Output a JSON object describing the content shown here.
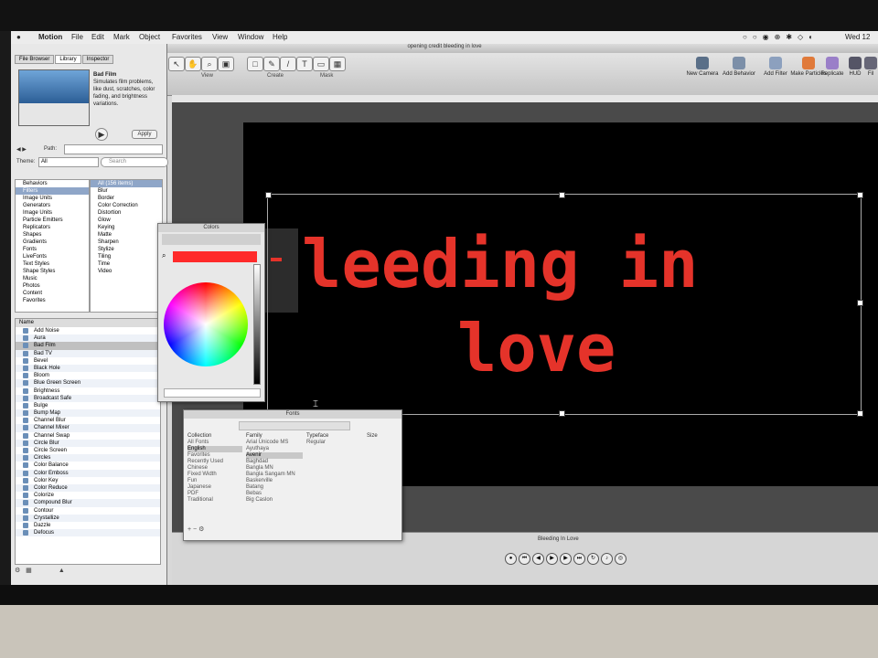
{
  "menubar": {
    "app": "Motion",
    "items": [
      "File",
      "Edit",
      "Mark",
      "Object",
      "Favorites",
      "View",
      "Window",
      "Help"
    ],
    "clock": "Wed 12"
  },
  "window": {
    "title": "opening credit bleeding in love"
  },
  "toolbar": {
    "view_label": "View",
    "create_label": "Create",
    "mask_label": "Mask",
    "right_buttons": [
      "New Camera",
      "Add Behavior",
      "Add Filter",
      "Make Particles",
      "Replicate",
      "HUD",
      "Fil"
    ]
  },
  "library": {
    "tabs": [
      "File Browser",
      "Library",
      "Inspector"
    ],
    "selected_item": "Bad Film",
    "description": "Simulates film problems, like dust, scratches, color fading, and brightness variations.",
    "apply_label": "Apply",
    "path_label": "Path:",
    "theme_label": "Theme:",
    "theme_value": "All",
    "search_placeholder": "Search",
    "categories": [
      "Behaviors",
      "Filters",
      "Image Units",
      "Generators",
      "Image Units",
      "Particle Emitters",
      "Replicators",
      "Shapes",
      "Gradients",
      "Fonts",
      "LiveFonts",
      "Text Styles",
      "Shape Styles",
      "Music",
      "Photos",
      "Content",
      "Favorites"
    ],
    "subcategories": [
      "All (156 items)",
      "Blur",
      "Border",
      "Color Correction",
      "Distortion",
      "Glow",
      "Keying",
      "Matte",
      "Sharpen",
      "Stylize",
      "Tiling",
      "Time",
      "Video"
    ],
    "list_header": "Name",
    "filters": [
      "Add Noise",
      "Aura",
      "Bad Film",
      "Bad TV",
      "Bevel",
      "Black Hole",
      "Bloom",
      "Blue Green Screen",
      "Brightness",
      "Broadcast Safe",
      "Bulge",
      "Bump Map",
      "Channel Blur",
      "Channel Mixer",
      "Channel Swap",
      "Circle Blur",
      "Circle Screen",
      "Circles",
      "Color Balance",
      "Color Emboss",
      "Color Key",
      "Color Reduce",
      "Colorize",
      "Compound Blur",
      "Contour",
      "Crystallize",
      "Dazzle",
      "Defocus"
    ]
  },
  "canvas": {
    "line1": "leeding in",
    "line2": "love",
    "text_color": "#e5332a"
  },
  "colors_panel": {
    "title": "Colors",
    "swatch_color": "#ff2a2a"
  },
  "fonts_panel": {
    "title": "Fonts",
    "collection_header": "Collection",
    "family_header": "Family",
    "typeface_header": "Typeface",
    "size_header": "Size",
    "collections": [
      "All Fonts",
      "English",
      "Favorites",
      "Recently Used",
      "Chinese",
      "Fixed Width",
      "Fun",
      "Japanese",
      "PDF",
      "Traditional"
    ],
    "families": [
      "Arial Unicode MS",
      "Ayuthaya",
      "Avenir",
      "Baghdad",
      "Bangla MN",
      "Bangla Sangam MN",
      "Baskerville",
      "Batang",
      "Bebas",
      "Big Caslon"
    ],
    "typefaces": [
      "Regular"
    ]
  },
  "timeline": {
    "label": "Bleeding In Love"
  }
}
